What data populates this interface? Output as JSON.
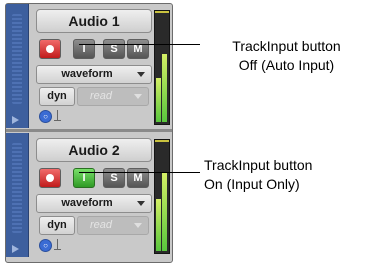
{
  "tracks": [
    {
      "name": "Audio 1",
      "input_button": "I",
      "input_state": "off",
      "solo": "S",
      "mute": "M",
      "view": "waveform",
      "dyn": "dyn",
      "automation": "read",
      "meter_level_left": 0.4,
      "meter_level_right": 0.62
    },
    {
      "name": "Audio 2",
      "input_button": "I",
      "input_state": "on",
      "solo": "S",
      "mute": "M",
      "view": "waveform",
      "dyn": "dyn",
      "automation": "read",
      "meter_level_left": 0.48,
      "meter_level_right": 0.72
    }
  ],
  "callouts": [
    {
      "line1": "TrackInput button",
      "line2": "Off (Auto Input)"
    },
    {
      "line1": "TrackInput button",
      "line2": "On (Input Only)"
    }
  ],
  "colors": {
    "record": "#d02a2a",
    "input_on": "#3fb534",
    "meter": "#7ad04a",
    "strip": "#3d5f9e"
  }
}
